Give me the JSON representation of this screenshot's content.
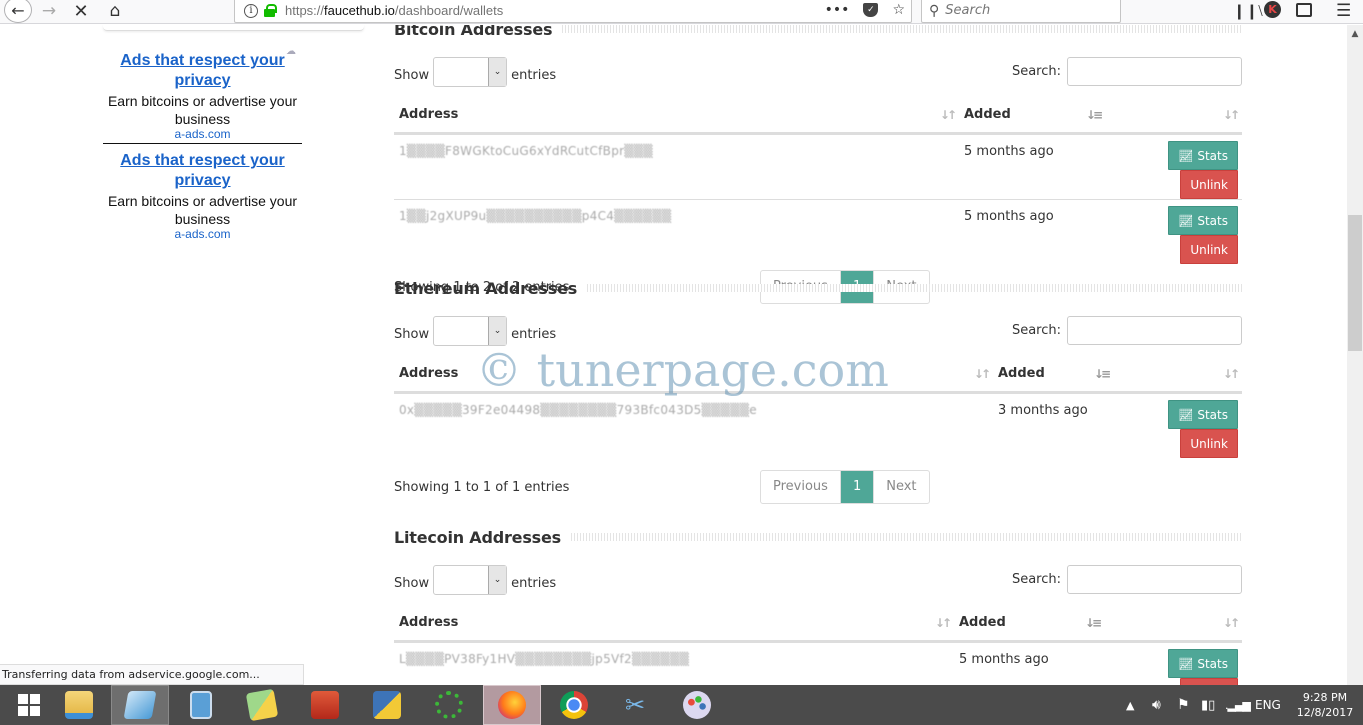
{
  "browser": {
    "url_prefix": "https://",
    "url_domain": "faucethub.io",
    "url_path": "/dashboard/wallets",
    "search_placeholder": "Search",
    "avatar_letter": "K",
    "status_text": "Transferring data from adservice.google.com..."
  },
  "sidebar": {
    "ads": [
      {
        "title": "Ads that respect your privacy",
        "desc": "Earn bitcoins or advertise your business",
        "domain": "a-ads.com"
      },
      {
        "title": "Ads that respect your privacy",
        "desc": "Earn bitcoins or advertise your business",
        "domain": "a-ads.com"
      }
    ]
  },
  "common": {
    "show_label": "Show",
    "entries_label": "entries",
    "search_label": "Search:",
    "col_address": "Address",
    "col_added": "Added",
    "stats_label": "Stats",
    "unlink_label": "Unlink",
    "prev_label": "Previous",
    "next_label": "Next",
    "page_current": "1"
  },
  "sections": [
    {
      "title": "Bitcoin Addresses",
      "rows": [
        {
          "address": "1▒▒▒▒F8WGKtoCuG6xYdRCutCfBpr▒▒▒",
          "added": "5 months ago"
        },
        {
          "address": "1▒▒j2gXUP9u▒▒▒▒▒▒▒▒▒▒p4C4▒▒▒▒▒▒",
          "added": "5 months ago"
        }
      ],
      "info": "Showing 1 to 2 of 2 entries"
    },
    {
      "title": "Ethereum Addresses",
      "rows": [
        {
          "address": "0x▒▒▒▒▒39F2e04498▒▒▒▒▒▒▒▒793Bfc043D5▒▒▒▒▒e",
          "added": "3 months ago"
        }
      ],
      "info": "Showing 1 to 1 of 1 entries"
    },
    {
      "title": "Litecoin Addresses",
      "rows": [
        {
          "address": "L▒▒▒▒PV38Fy1HV▒▒▒▒▒▒▒▒jp5Vf2▒▒▒▒▒▒",
          "added": "5 months ago"
        }
      ]
    }
  ],
  "watermark": "© tunerpage.com",
  "taskbar": {
    "apps": [
      "start",
      "file-explorer",
      "notepad",
      "calculator",
      "sticky-notes",
      "app-red",
      "python-idle",
      "green-ring-app",
      "firefox",
      "chrome",
      "snipping-tool",
      "paint"
    ],
    "language": "ENG",
    "time": "9:28 PM",
    "date": "12/8/2017"
  }
}
